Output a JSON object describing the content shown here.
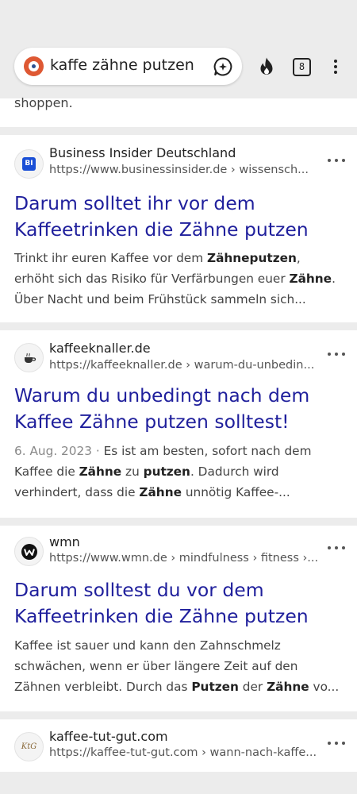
{
  "search": {
    "query": "kaffe zähne putzen"
  },
  "toolbar": {
    "tab_count": "8"
  },
  "first_card": {
    "snippet_tail": "shoppen."
  },
  "results": [
    {
      "site_name": "Business Insider Deutschland",
      "url": "https://www.businessinsider.de › wissensch...",
      "icon_text": "BI",
      "title": "Darum solltet ihr vor dem Kaffeetrinken die Zähne putzen",
      "snippet": [
        {
          "t": "Trinkt ihr euren Kaffee vor dem "
        },
        {
          "t": "Zähneputzen",
          "b": true
        },
        {
          "t": ", erhöht sich das Risiko für Verfärbungen euer "
        },
        {
          "t": "Zähne",
          "b": true
        },
        {
          "t": ". Über Nacht und beim Frühstück sammeln sich..."
        }
      ]
    },
    {
      "site_name": "kaffeeknaller.de",
      "url": "https://kaffeeknaller.de › warum-du-unbedin...",
      "title": "Warum du unbedingt nach dem Kaffee Zähne putzen solltest!",
      "date": "6. Aug. 2023 · ",
      "snippet": [
        {
          "t": "Es ist am besten, sofort nach dem Kaffee die "
        },
        {
          "t": "Zähne",
          "b": true
        },
        {
          "t": " zu "
        },
        {
          "t": "putzen",
          "b": true
        },
        {
          "t": ". Dadurch wird verhindert, dass die "
        },
        {
          "t": "Zähne",
          "b": true
        },
        {
          "t": " unnötig Kaffee-..."
        }
      ]
    },
    {
      "site_name": "wmn",
      "url": "https://www.wmn.de › mindfulness › fitness ›...",
      "title": "Darum solltest du vor dem Kaffeetrinken die Zähne putzen",
      "snippet": [
        {
          "t": "Kaffee ist sauer und kann den Zahnschmelz schwächen, wenn er über längere Zeit auf den Zähnen verbleibt. Durch das "
        },
        {
          "t": "Putzen",
          "b": true
        },
        {
          "t": " der "
        },
        {
          "t": "Zähne",
          "b": true
        },
        {
          "t": " vo..."
        }
      ]
    },
    {
      "site_name": "kaffee-tut-gut.com",
      "url": "https://kaffee-tut-gut.com › wann-nach-kaffe...",
      "icon_text": "KtG"
    }
  ]
}
